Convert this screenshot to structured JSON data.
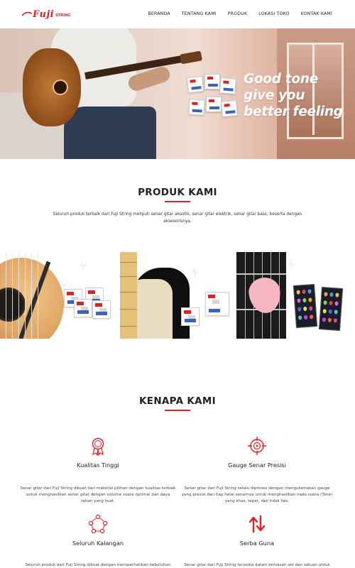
{
  "brand": {
    "logo_text": "Fuji",
    "logo_sub": "STRING",
    "accent_color": "#e31e24"
  },
  "nav": {
    "items": [
      {
        "label": "BERANDA"
      },
      {
        "label": "TENTANG KAMI"
      },
      {
        "label": "PRODUK"
      },
      {
        "label": "LOKASI TOKO"
      },
      {
        "label": "KONTAK KAMI"
      }
    ]
  },
  "hero": {
    "tagline_line1": "Good tone",
    "tagline_line2": "give you",
    "tagline_line3": "better feeling"
  },
  "products_section": {
    "title": "PRODUK KAMI",
    "description": "Seluruh produk terbaik dari Fuji String meliputi senar gitar akustik, senar gitar elektrik, senar gitar bass, beserta dengan aksesorisnya."
  },
  "why_section": {
    "title": "KENAPA KAMI",
    "features": [
      {
        "icon": "award-medal-icon",
        "title": "Kualitas Tinggi",
        "description": "Senar gitar dari Fuji String dibuat dari material pilihan dengan kualitas terbaik untuk menghasilkan senar gitar dengan volume suara optimal dan daya tahan yang kuat."
      },
      {
        "icon": "target-crosshair-icon",
        "title": "Gauge Senar Presisi",
        "description": "Senar gitar dari Fuji String selalu diproses dengan mengutamakan gauge yang presisi dari tiap helai senarnya untuk menghasilkan nada suara (Tone) yang khas, tepat, dan tidak fals."
      },
      {
        "icon": "people-network-icon",
        "title": "Seluruh Kalangan",
        "description": "Seluruh produk dari Fuji String dibuat dengan memperhatikan kebutuhan"
      },
      {
        "icon": "up-down-arrows-icon",
        "title": "Serba Guna",
        "description": "Senar gitar dari Fuji String tersedia dalam kemasan set dan satuan untuk"
      }
    ]
  }
}
